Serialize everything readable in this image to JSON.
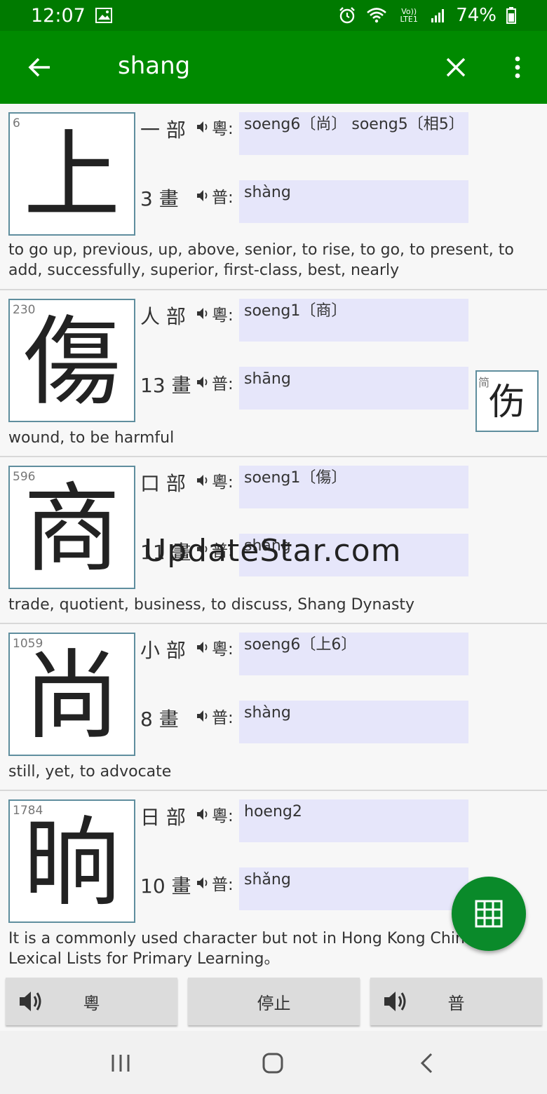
{
  "status": {
    "time": "12:07",
    "battery": "74%",
    "network": "Vo)) LTE1"
  },
  "toolbar": {
    "search_text": "shang"
  },
  "entries": [
    {
      "index": "6",
      "char": "上",
      "radical": "一 部",
      "strokes": "3 畫",
      "jyut_label": "粵:",
      "pin_label": "普:",
      "jyutping": "soeng6〔尚〕 soeng5〔相5〕",
      "pinyin": "shàng",
      "meaning": "to go up, previous, up, above, senior, to rise, to go, to present, to add, successfully, superior, first-class, best, nearly"
    },
    {
      "index": "230",
      "char": "傷",
      "radical": "人 部",
      "strokes": "13 畫",
      "jyut_label": "粵:",
      "pin_label": "普:",
      "jyutping": "soeng1〔商〕",
      "pinyin": "shāng",
      "meaning": "wound, to be harmful",
      "simplified_tag": "简",
      "simplified_char": "伤"
    },
    {
      "index": "596",
      "char": "商",
      "radical": "口 部",
      "strokes": "11 畫",
      "jyut_label": "粵:",
      "pin_label": "普:",
      "jyutping": "soeng1〔傷〕",
      "pinyin": "shāng",
      "meaning": "trade, quotient, business, to discuss, Shang Dynasty"
    },
    {
      "index": "1059",
      "char": "尚",
      "radical": "小 部",
      "strokes": "8 畫",
      "jyut_label": "粵:",
      "pin_label": "普:",
      "jyutping": "soeng6〔上6〕",
      "pinyin": "shàng",
      "meaning": "still, yet, to advocate"
    },
    {
      "index": "1784",
      "char": "晌",
      "radical": "日 部",
      "strokes": "10 畫",
      "jyut_label": "粵:",
      "pin_label": "普:",
      "jyutping": "hoeng2",
      "pinyin": "shǎng",
      "meaning": "It is a commonly used character but not in Hong Kong Chinese Lexical Lists for Primary Learning。"
    }
  ],
  "watermark": "UpdateStar.com",
  "bottom_buttons": {
    "cantonese": "粵",
    "stop": "停止",
    "mandarin": "普"
  },
  "colors": {
    "status_bar": "#007a00",
    "app_bar": "#008a00",
    "fab": "#0a8a2a",
    "pron_box": "#e6e6fa"
  }
}
